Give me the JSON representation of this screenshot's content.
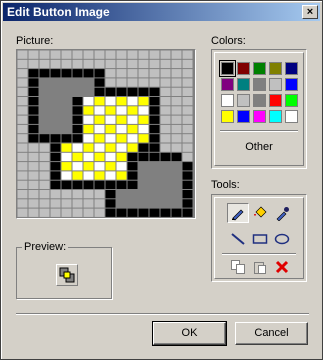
{
  "window": {
    "title": "Edit Button Image",
    "close_glyph": "×"
  },
  "picture": {
    "label": "Picture:",
    "palette": {
      ".": "#c0c0c0",
      "K": "#000000",
      "G": "#808080",
      "W": "#ffffff",
      "Y": "#ffff00"
    },
    "rows": [
      "................",
      "................",
      ".KKKKKKK........",
      ".KGGGGGK........",
      ".KGGGGGKKKKKK...",
      ".KGGGKWYWYWYK...",
      ".KGGGKYWYWYWK...",
      ".KGGGKWYWYWYK...",
      ".KGGGKYWYWYWK...",
      ".KKKKKWYWYWYK...",
      "...KYWYWYWYKK...",
      "...KWYWYWYKKKKK.",
      "...KYWYWYWKGGGGK",
      "...KWYWYWYKGGGGK",
      "...KKKKKKKKGGGGK",
      "........KGGGGGGK",
      "........KGGGGGGK",
      "........KKKKKKKK"
    ]
  },
  "preview": {
    "label": "Preview:"
  },
  "colors": {
    "label": "Colors:",
    "swatches": [
      [
        "#000000",
        "#800000",
        "#008000",
        "#808000",
        "#000080"
      ],
      [
        "#800080",
        "#008080",
        "#808080",
        "#c0c0c0",
        "#0000ff"
      ],
      [
        "#ffffff",
        "#c0c0c0",
        "#808080",
        "#ff0000",
        "#00ff00"
      ],
      [
        "#ffff00",
        "#0000ff",
        "#ff00ff",
        "#00ffff",
        "#ffffff"
      ]
    ],
    "selected_index": 0,
    "other_label": "Other"
  },
  "tools": {
    "label": "Tools:",
    "items": [
      "pencil-icon",
      "fill-icon",
      "eyedropper-icon",
      "line-icon",
      "rectangle-icon",
      "ellipse-icon",
      "copy-icon",
      "paste-icon",
      "clear-icon"
    ],
    "selected": "pencil-icon"
  },
  "buttons": {
    "ok": "OK",
    "cancel": "Cancel"
  }
}
